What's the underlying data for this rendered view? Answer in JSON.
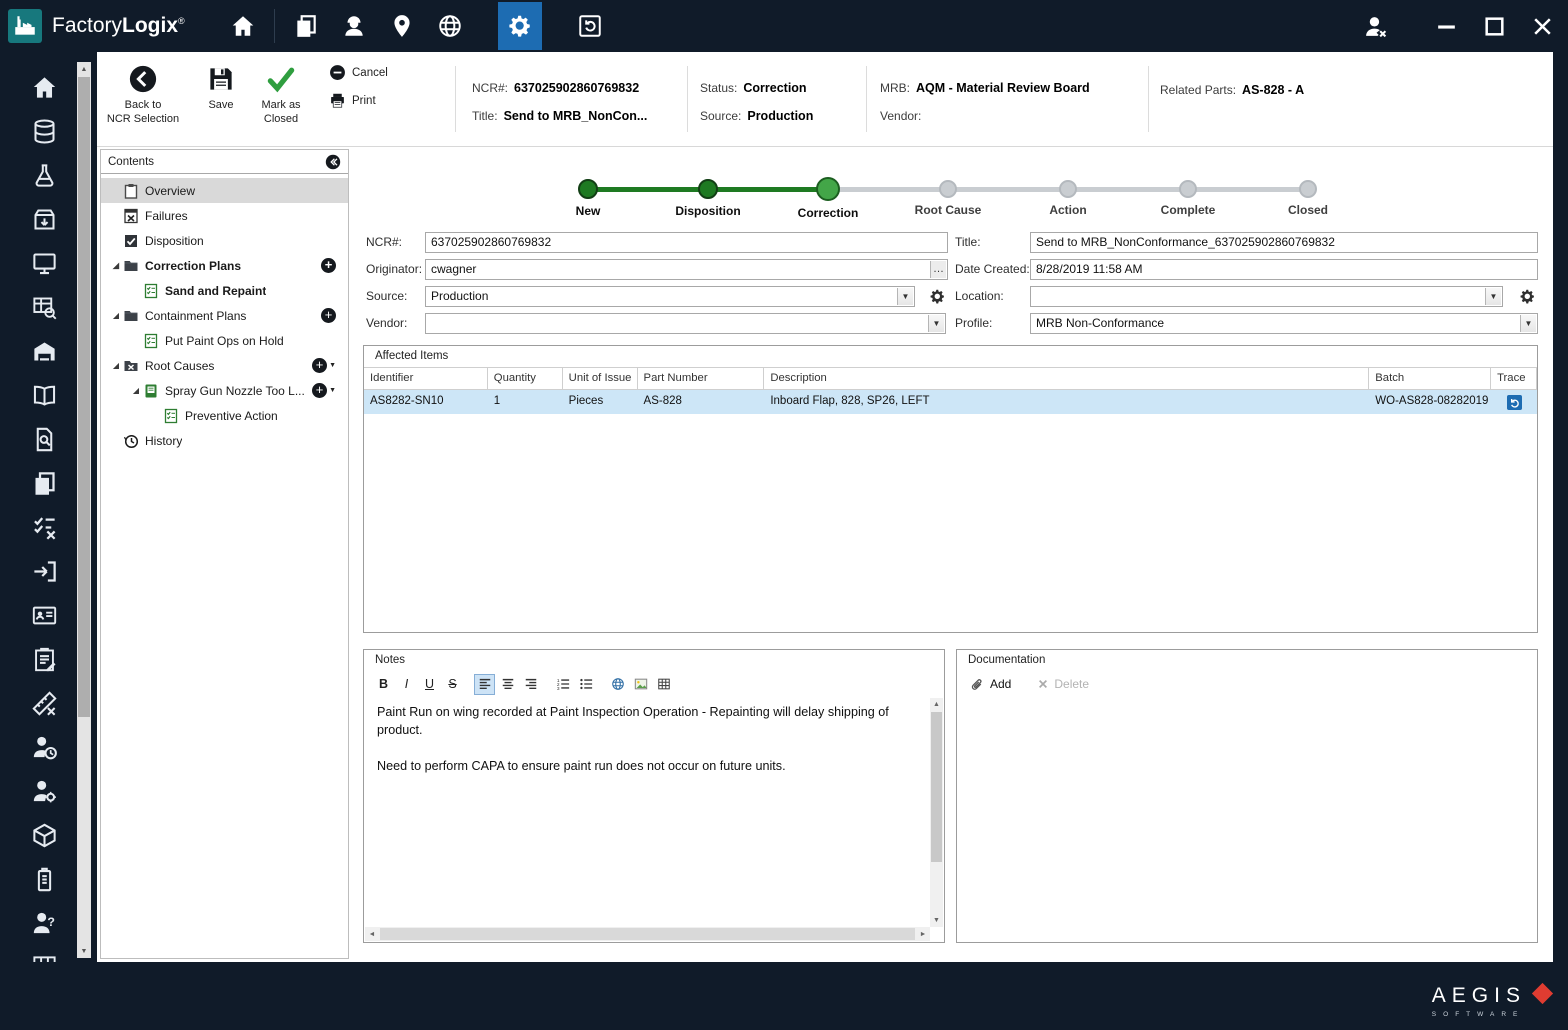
{
  "titlebar": {
    "app_name_regular": "Factory",
    "app_name_bold": "Logix",
    "registered_mark": "®",
    "icons": [
      {
        "name": "home",
        "icon": "house"
      },
      {
        "sep": true
      },
      {
        "name": "pages",
        "icon": "pages"
      },
      {
        "name": "engineer",
        "icon": "engineer"
      },
      {
        "name": "map-pin",
        "icon": "map-pin"
      },
      {
        "name": "globe",
        "icon": "globe"
      },
      {
        "name": "gear",
        "icon": "gear",
        "selected": true
      },
      {
        "name": "undo-box",
        "icon": "undo-box"
      }
    ],
    "window_buttons": [
      {
        "name": "user-signout",
        "icon": "user-logout"
      },
      {
        "name": "minimize",
        "icon": "win-min"
      },
      {
        "name": "maximize",
        "icon": "win-max"
      },
      {
        "name": "close",
        "icon": "win-close"
      }
    ]
  },
  "toolbar": {
    "back_line1": "Back to",
    "back_line2": "NCR Selection",
    "save_label": "Save",
    "mark_line1": "Mark as",
    "mark_line2": "Closed",
    "cancel_label": "Cancel",
    "print_label": "Print"
  },
  "header_info": {
    "ncr_label": "NCR#:",
    "ncr_value": "637025902860769832",
    "title_label": "Title:",
    "title_value": "Send to MRB_NonCon...",
    "status_label": "Status:",
    "status_value": "Correction",
    "source_label": "Source:",
    "source_value": "Production",
    "mrb_label": "MRB:",
    "mrb_value": "AQM - Material Review Board",
    "vendor_label": "Vendor:",
    "vendor_value": "",
    "related_label": "Related Parts:",
    "related_value": "AS-828 - A"
  },
  "sidebar": {
    "icons": [
      "house",
      "database-stack",
      "flask",
      "box-return",
      "monitor",
      "table-search",
      "warehouse",
      "open-book",
      "doc-search",
      "pages",
      "checklist-x",
      "arrow-export",
      "id-card",
      "clipboard-edit",
      "ruler-cross",
      "person-clock",
      "person-gear",
      "box-plus",
      "doc-battery",
      "person-question",
      "grid"
    ]
  },
  "contents": {
    "header": "Contents",
    "items": [
      {
        "label": "Overview",
        "icon": "clipboard",
        "level": 0,
        "selected": true
      },
      {
        "label": "Failures",
        "icon": "failure-doc",
        "level": 0
      },
      {
        "label": "Disposition",
        "icon": "check-doc",
        "level": 0
      },
      {
        "label": "Correction Plans",
        "icon": "folder",
        "level": 0,
        "bold": true,
        "expanded": true,
        "add": true
      },
      {
        "label": "Sand and Repaint",
        "icon": "checklist-green",
        "level": 1,
        "bold": true
      },
      {
        "label": "Containment Plans",
        "icon": "folder",
        "level": 0,
        "expanded": true,
        "add": true
      },
      {
        "label": "Put Paint Ops on Hold",
        "icon": "checklist-green",
        "level": 1
      },
      {
        "label": "Root Causes",
        "icon": "folder-x",
        "level": 0,
        "expanded": true,
        "add": true,
        "add_menu": true
      },
      {
        "label": "Spray Gun Nozzle Too L...",
        "icon": "book-green",
        "level": 1,
        "expanded": true,
        "add": true,
        "add_menu": true
      },
      {
        "label": "Preventive Action",
        "icon": "checklist-green",
        "level": 2
      },
      {
        "label": "History",
        "icon": "history-clock",
        "level": 0
      }
    ]
  },
  "stepper": {
    "steps": [
      {
        "label": "New",
        "state": "done"
      },
      {
        "label": "Disposition",
        "state": "done"
      },
      {
        "label": "Correction",
        "state": "current"
      },
      {
        "label": "Root Cause",
        "state": "todo"
      },
      {
        "label": "Action",
        "state": "todo"
      },
      {
        "label": "Complete",
        "state": "todo"
      },
      {
        "label": "Closed",
        "state": "todo"
      }
    ]
  },
  "form": {
    "ncr": {
      "label": "NCR#:",
      "value": "637025902860769832"
    },
    "title": {
      "label": "Title:",
      "value": "Send to MRB_NonConformance_637025902860769832"
    },
    "originator": {
      "label": "Originator:",
      "value": "cwagner",
      "browse_glyph": "…"
    },
    "date_created": {
      "label": "Date Created:",
      "value": "8/28/2019 11:58 AM"
    },
    "source": {
      "label": "Source:",
      "value": "Production"
    },
    "location": {
      "label": "Location:",
      "value": ""
    },
    "vendor": {
      "label": "Vendor:",
      "value": ""
    },
    "profile": {
      "label": "Profile:",
      "value": "MRB Non-Conformance"
    }
  },
  "affected_items": {
    "title": "Affected Items",
    "columns": [
      "Identifier",
      "Quantity",
      "Unit of Issue",
      "Part Number",
      "Description",
      "Batch",
      "Trace"
    ],
    "rows": [
      {
        "cells": [
          "AS8282-SN10",
          "1",
          "Pieces",
          "AS-828",
          "Inboard Flap, 828, SP26, LEFT",
          "WO-AS828-08282019"
        ],
        "selected": true
      }
    ]
  },
  "notes": {
    "title": "Notes",
    "toolbar": [
      {
        "name": "bold"
      },
      {
        "name": "italic"
      },
      {
        "name": "underline"
      },
      {
        "name": "strikethrough"
      },
      {
        "gap": true
      },
      {
        "name": "align-left",
        "selected": true
      },
      {
        "name": "align-center"
      },
      {
        "name": "align-right"
      },
      {
        "gap": true
      },
      {
        "name": "num-list"
      },
      {
        "name": "bullet-list"
      },
      {
        "gap": true
      },
      {
        "name": "globe-link"
      },
      {
        "name": "image"
      },
      {
        "name": "table-grid"
      }
    ],
    "paragraphs": [
      "Paint Run on wing recorded at Paint Inspection Operation - Repainting will delay shipping of product.",
      "Need to perform CAPA to ensure paint run does not occur on future units."
    ]
  },
  "documentation": {
    "title": "Documentation",
    "add_label": "Add",
    "delete_label": "Delete"
  },
  "footer": {
    "brand": "AEGIS",
    "brand_sub": "SOFTWARE"
  },
  "colors": {
    "navy": "#101b29",
    "teal": "#17787d",
    "accent_blue": "#1d6cb2",
    "green_done": "#1e7a22",
    "green_current": "#43a648",
    "row_selected": "#cde6f7"
  }
}
